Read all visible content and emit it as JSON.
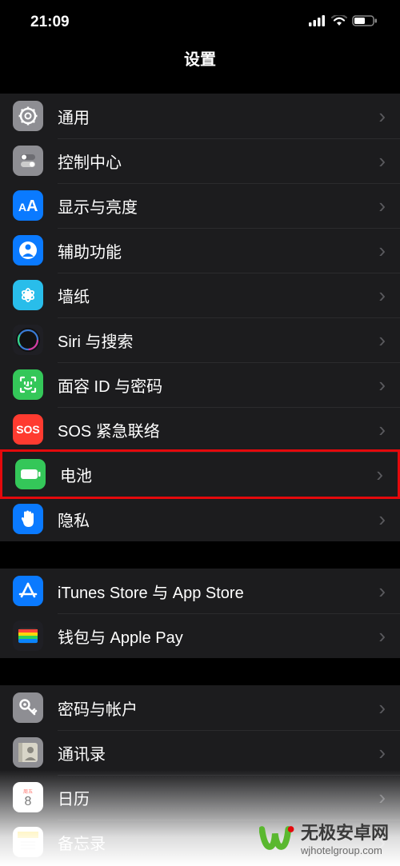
{
  "status": {
    "time": "21:09"
  },
  "header": {
    "title": "设置"
  },
  "groups": [
    {
      "items": [
        {
          "id": "general",
          "label": "通用",
          "bg": "#8e8e93",
          "svg": "gear"
        },
        {
          "id": "control-center",
          "label": "控制中心",
          "bg": "#8e8e93",
          "svg": "toggles"
        },
        {
          "id": "display",
          "label": "显示与亮度",
          "bg": "#0a7aff",
          "svg": "AA"
        },
        {
          "id": "accessibility",
          "label": "辅助功能",
          "bg": "#0a7aff",
          "svg": "person"
        },
        {
          "id": "wallpaper",
          "label": "墙纸",
          "bg": "#29bdea",
          "svg": "flower"
        },
        {
          "id": "siri",
          "label": "Siri 与搜索",
          "bg": "#1f1f24",
          "svg": "siri"
        },
        {
          "id": "face-id",
          "label": "面容 ID 与密码",
          "bg": "#34c759",
          "svg": "faceid"
        },
        {
          "id": "sos",
          "label": "SOS 紧急联络",
          "bg": "#ff3b30",
          "svg": "SOS"
        },
        {
          "id": "battery",
          "label": "电池",
          "bg": "#34c759",
          "svg": "battery",
          "highlight": true
        },
        {
          "id": "privacy",
          "label": "隐私",
          "bg": "#0a7aff",
          "svg": "hand"
        }
      ]
    },
    {
      "items": [
        {
          "id": "itunes",
          "label": "iTunes Store 与 App Store",
          "bg": "#0a7aff",
          "svg": "appstore"
        },
        {
          "id": "wallet",
          "label": "钱包与 Apple Pay",
          "bg": "#1f1f24",
          "svg": "wallet"
        }
      ]
    },
    {
      "items": [
        {
          "id": "passwords",
          "label": "密码与帐户",
          "bg": "#8e8e93",
          "svg": "key"
        },
        {
          "id": "contacts",
          "label": "通讯录",
          "bg": "#8e8e93",
          "svg": "contact"
        },
        {
          "id": "calendar",
          "label": "日历",
          "bg": "#ffffff",
          "svg": "cal"
        },
        {
          "id": "notes",
          "label": "备忘录",
          "bg": "#ffffff",
          "svg": "notes"
        }
      ]
    }
  ],
  "watermark": {
    "brand": "无极安卓网",
    "url": "wjhotelgroup.com"
  }
}
